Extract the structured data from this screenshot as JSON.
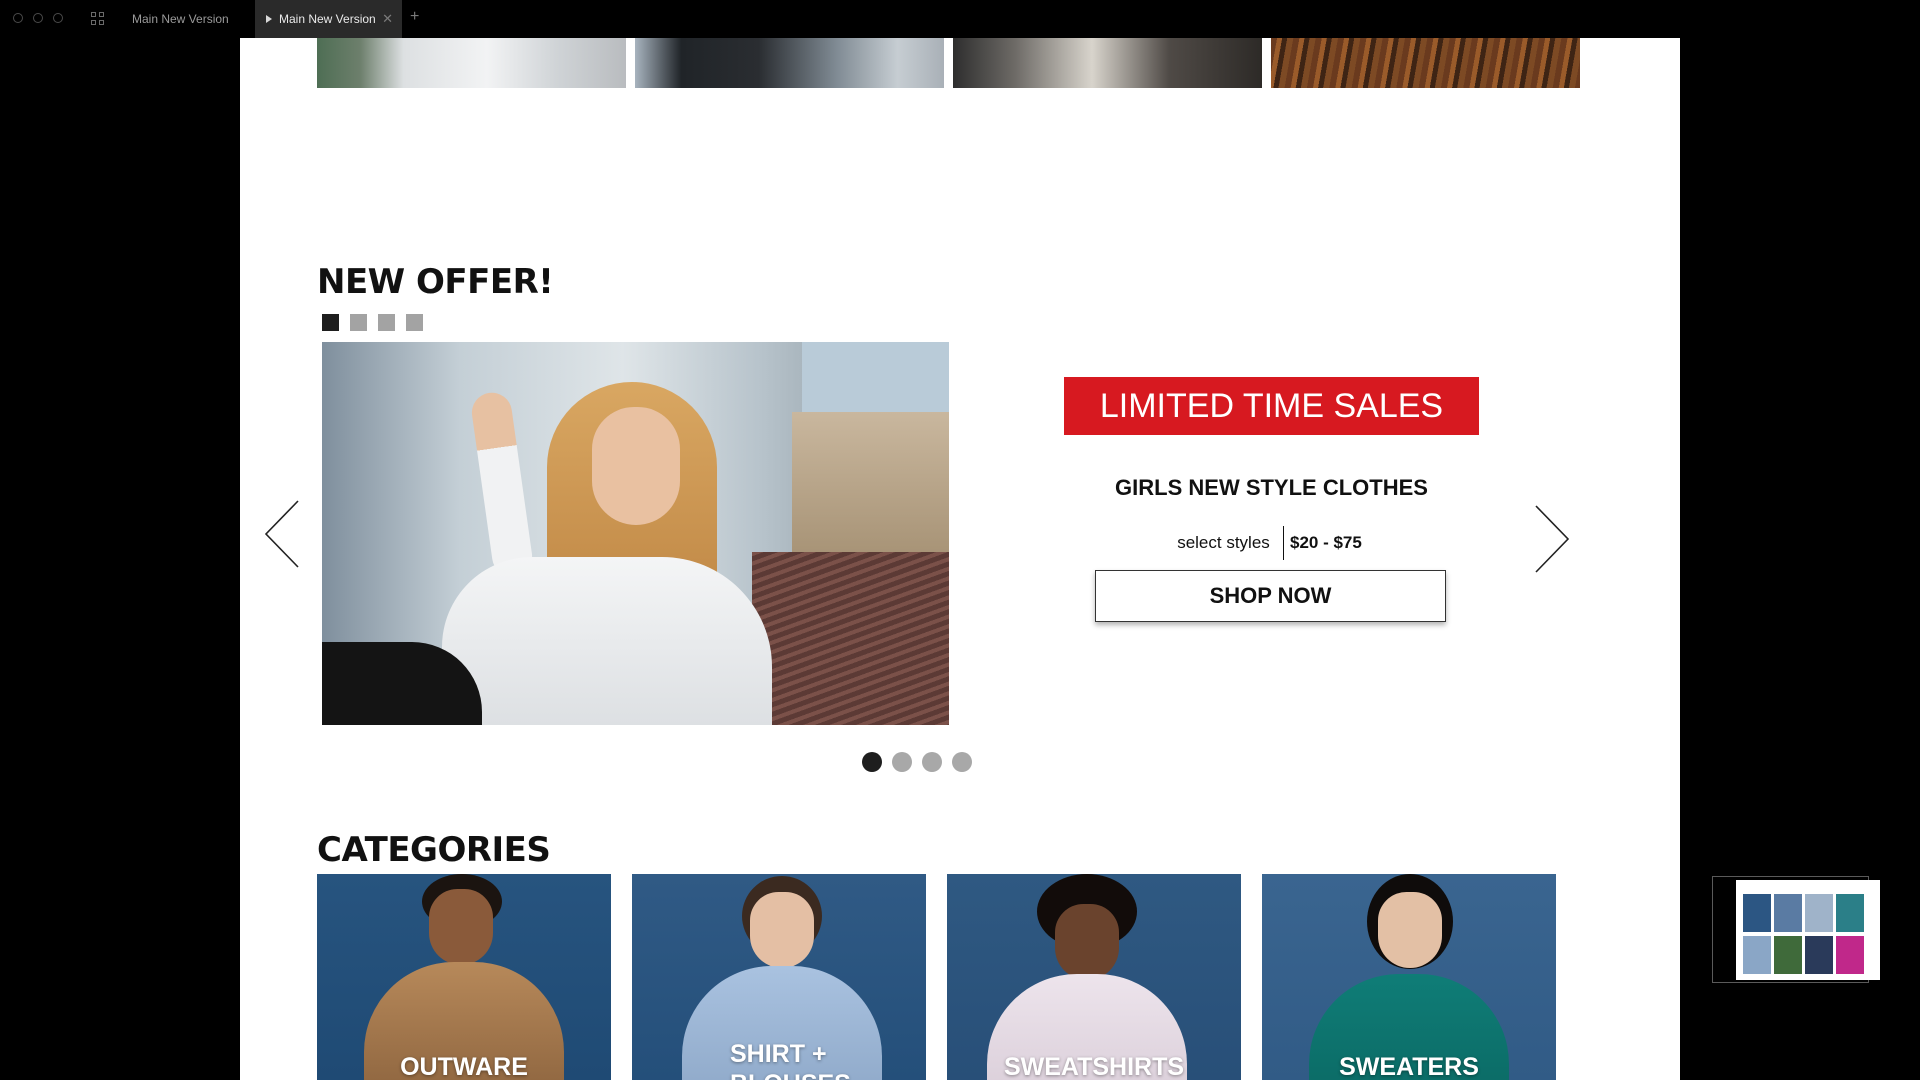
{
  "window": {
    "tabs": [
      {
        "label": "Main New Version",
        "active": false
      },
      {
        "label": "Main New Version",
        "active": true
      }
    ]
  },
  "new_offer": {
    "title": "NEW OFFER!",
    "thumbnail_count": 4,
    "active_thumbnail": 1,
    "slide_count": 4,
    "active_slide": 1,
    "promo": {
      "banner": "LIMITED TIME SALES",
      "headline": "GIRLS NEW STYLE CLOTHES",
      "select_label": "select styles",
      "price_range": "$20 - $75",
      "cta": "SHOP NOW"
    },
    "colors": {
      "banner_red": "#d71920",
      "active_indicator": "#1e1e1e",
      "inactive_indicator": "#a8a8a8"
    }
  },
  "categories": {
    "title": "CATEGORIES",
    "items": [
      {
        "label": "OUTWARE"
      },
      {
        "label": "SHIRT + BLOUSES"
      },
      {
        "label": "SWEATSHIRTS"
      },
      {
        "label": "SWEATERS"
      }
    ]
  }
}
